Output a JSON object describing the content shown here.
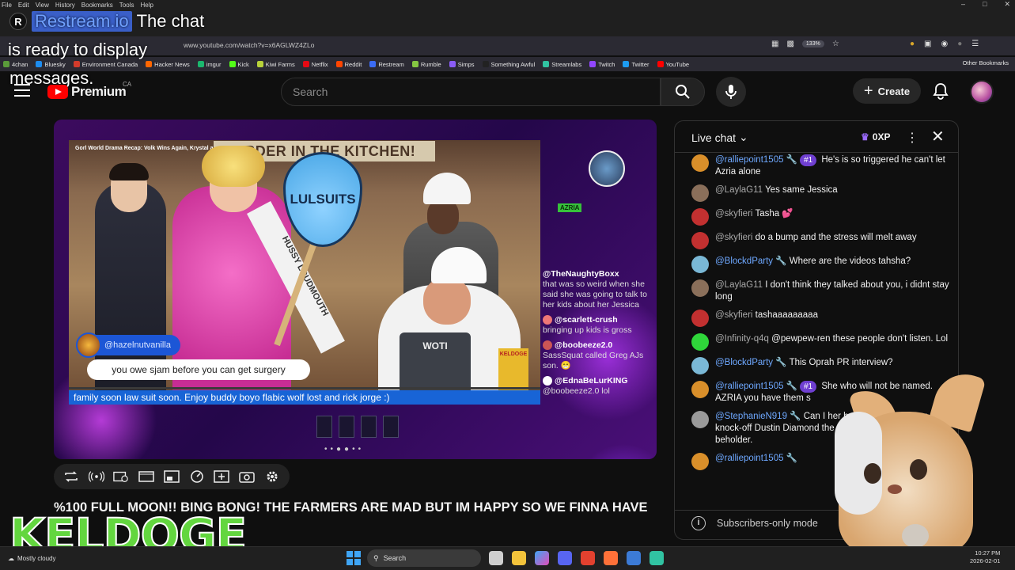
{
  "browser": {
    "menu": [
      "File",
      "Edit",
      "View",
      "History",
      "Bookmarks",
      "Tools",
      "Help"
    ],
    "url": "www.youtube.com/watch?v=x6AGLWZ4ZLo",
    "zoom": "133%",
    "bookmarks": [
      {
        "label": "4chan",
        "color": "#5a9a3a"
      },
      {
        "label": "Bluesky",
        "color": "#1d8cf0"
      },
      {
        "label": "Environment Canada",
        "color": "#d23b2b"
      },
      {
        "label": "Hacker News",
        "color": "#ff6600"
      },
      {
        "label": "imgur",
        "color": "#1bb76e"
      },
      {
        "label": "Kick",
        "color": "#53fc18"
      },
      {
        "label": "Kiwi Farms",
        "color": "#b8d23a"
      },
      {
        "label": "Netflix",
        "color": "#e50914"
      },
      {
        "label": "Reddit",
        "color": "#ff4500"
      },
      {
        "label": "Restream",
        "color": "#3b6cf6"
      },
      {
        "label": "Rumble",
        "color": "#85c742"
      },
      {
        "label": "Simps",
        "color": "#8a5cf6"
      },
      {
        "label": "Something Awful",
        "color": "#222222"
      },
      {
        "label": "Streamlabs",
        "color": "#31c3a2"
      },
      {
        "label": "Twitch",
        "color": "#9146ff"
      },
      {
        "label": "Twitter",
        "color": "#1d9bf0"
      },
      {
        "label": "YouTube",
        "color": "#ff0000"
      }
    ],
    "other_bookmarks": "Other Bookmarks"
  },
  "overlay": {
    "logo": "R",
    "user": "Restream.io",
    "line1": "The chat",
    "line2": "is ready to display",
    "line3": "messages."
  },
  "header": {
    "logo_text": "Premium",
    "country": "CA",
    "search_placeholder": "Search",
    "create_label": "Create"
  },
  "video": {
    "stream_title_overlay": "Gorl World Drama Recap: Volk Wins Again, Krystal and Ab...",
    "sign_text": "ORDER IN THE KITCHEN!",
    "drop_text": "LULSUITS",
    "sash_text": "HUSSY LOUDMOUTH",
    "apron_text": "WOTI",
    "cereal_text": "KELDOGE",
    "alert_user": "@hazelnutvanilla",
    "alert_message": "you owe sjam before you can get surgery",
    "ticker": "family soon law suit soon. Enjoy buddy boyo flabic wolf lost and rick jorge :)",
    "azria_tag": "AZRIA",
    "stream_chat": [
      {
        "user": "@TheNaughtyBoxx",
        "text": "that was so weird when she said she was going to talk to her kids about her Jessica",
        "color": ""
      },
      {
        "user": "@scarlett-crush",
        "text": "bringing up kids is gross",
        "color": "#e77"
      },
      {
        "user": "@boobeeze2.0",
        "text": "SassSquat called Greg AJs son. 😁",
        "color": "#c55"
      },
      {
        "user": "@EdnaBeLurKING",
        "text": "@boobeeze2.0 lol",
        "color": "#fff"
      }
    ],
    "title": "%100 FULL MOON!! BING BONG! THE FARMERS ARE MAD BUT IM HAPPY SO WE FINNA HAVE",
    "overlay_brand": "KELDOGE"
  },
  "chat": {
    "title": "Live chat",
    "xp": "0XP",
    "messages": [
      {
        "user": "@ralliepoint1505",
        "badge": "#1",
        "text": "He's is so triggered he can't let Azria alone",
        "av": "#d98f2a",
        "gray": false
      },
      {
        "user": "@LaylaG11",
        "badge": "",
        "text": "Yes same Jessica",
        "av": "#8a6f5a",
        "gray": true
      },
      {
        "user": "@skyfieri",
        "badge": "",
        "text": "Tasha 💕",
        "av": "#c23030",
        "gray": true
      },
      {
        "user": "@skyfieri",
        "badge": "",
        "text": "do a bump and the stress will melt away",
        "av": "#c23030",
        "gray": true
      },
      {
        "user": "@BlockdParty",
        "badge": "",
        "text": "Where are the videos tahsha?",
        "av": "#7ab8d6",
        "gray": false
      },
      {
        "user": "@LaylaG11",
        "badge": "",
        "text": "I don't think they talked about you, i didnt stay long",
        "av": "#8a6f5a",
        "gray": true
      },
      {
        "user": "@skyfieri",
        "badge": "",
        "text": "tashaaaaaaaaa",
        "av": "#c23030",
        "gray": true
      },
      {
        "user": "@Infinity-q4q",
        "badge": "",
        "text": "@pewpew-ren these people don't listen. Lol",
        "av": "#2fd63a",
        "gray": true
      },
      {
        "user": "@BlockdParty",
        "badge": "",
        "text": "This Oprah PR interview?",
        "av": "#7ab8d6",
        "gray": false
      },
      {
        "user": "@ralliepoint1505",
        "badge": "#1",
        "text": "She who will not be named. AZRIA you have them s",
        "av": "#d98f2a",
        "gray": false
      },
      {
        "user": "@StephanieN919",
        "badge": "",
        "text": "Can I her husband is gorgeous. I knock-off Dustin Diamond the Bell. I guess beauty truly beholder.",
        "av": "#9a9a9a",
        "gray": false
      },
      {
        "user": "@ralliepoint1505",
        "badge": "",
        "text": "",
        "av": "#d98f2a",
        "gray": false
      }
    ],
    "footer": "Subscribers-only mode"
  },
  "taskbar": {
    "weather": "Mostly cloudy",
    "search": "Search",
    "time": "10:27 PM",
    "date": "2026-02-01"
  }
}
